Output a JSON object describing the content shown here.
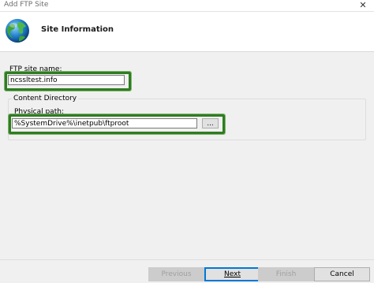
{
  "window": {
    "title": "Add FTP Site",
    "close_glyph": "✕"
  },
  "header": {
    "heading": "Site Information",
    "icon": "globe-icon"
  },
  "form": {
    "site_name_label": "FTP site name:",
    "site_name_value": "ncssltest.info",
    "group_label": "Content Directory",
    "physical_path_label": "Physical path:",
    "physical_path_value": "%SystemDrive%\\inetpub\\ftproot",
    "browse_label": "..."
  },
  "footer": {
    "previous_label": "Previous",
    "next_label": "Next",
    "finish_label": "Finish",
    "cancel_label": "Cancel"
  },
  "colors": {
    "highlight": "#2e7d21",
    "accent": "#0078d7"
  }
}
